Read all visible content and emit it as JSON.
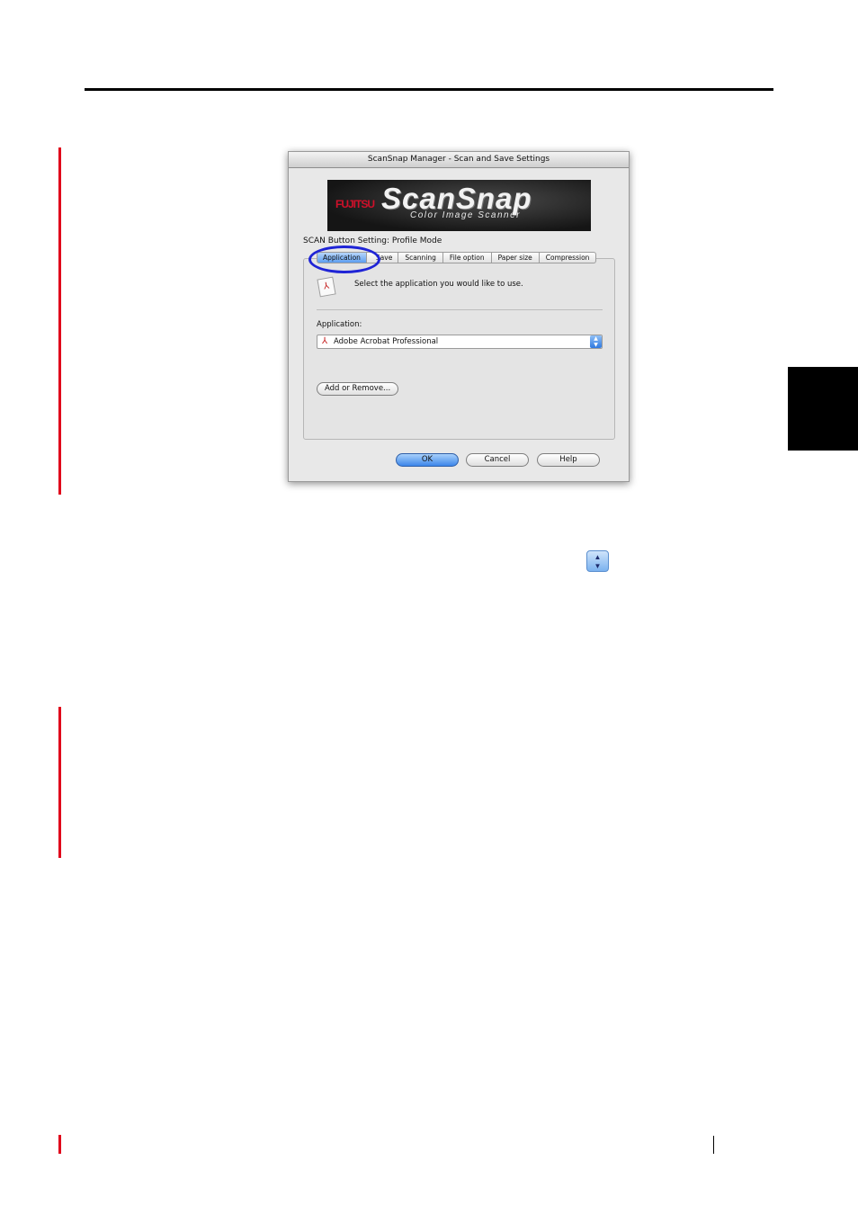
{
  "dialog": {
    "title": "ScanSnap Manager - Scan and Save Settings",
    "banner": {
      "brand": "FUJITSU",
      "product": "ScanSnap",
      "tagline": "Color Image Scanner"
    },
    "mode_label": "SCAN Button Setting: Profile Mode",
    "tabs": [
      "Application",
      "Save",
      "Scanning",
      "File option",
      "Paper size",
      "Compression"
    ],
    "active_tab": "Application",
    "instruction": "Select the application you would like to use.",
    "application_label": "Application:",
    "application_value": "Adobe Acrobat Professional",
    "add_remove_label": "Add or Remove...",
    "buttons": {
      "ok": "OK",
      "cancel": "Cancel",
      "help": "Help"
    }
  },
  "colors": {
    "margin_bar": "#e0001b",
    "highlight": "#1f24d6",
    "tab_marker": "#000000"
  }
}
